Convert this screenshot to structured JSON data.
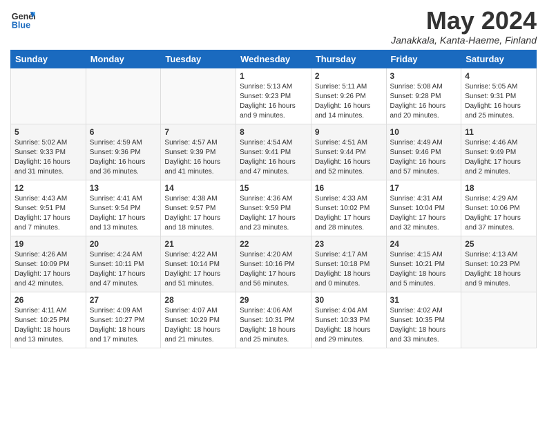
{
  "header": {
    "logo_general": "General",
    "logo_blue": "Blue",
    "month_title": "May 2024",
    "location": "Janakkala, Kanta-Haeme, Finland"
  },
  "days_of_week": [
    "Sunday",
    "Monday",
    "Tuesday",
    "Wednesday",
    "Thursday",
    "Friday",
    "Saturday"
  ],
  "weeks": [
    [
      {
        "day": "",
        "sunrise": "",
        "sunset": "",
        "daylight": ""
      },
      {
        "day": "",
        "sunrise": "",
        "sunset": "",
        "daylight": ""
      },
      {
        "day": "",
        "sunrise": "",
        "sunset": "",
        "daylight": ""
      },
      {
        "day": "1",
        "sunrise": "5:13 AM",
        "sunset": "9:23 PM",
        "daylight": "16 hours and 9 minutes."
      },
      {
        "day": "2",
        "sunrise": "5:11 AM",
        "sunset": "9:26 PM",
        "daylight": "16 hours and 14 minutes."
      },
      {
        "day": "3",
        "sunrise": "5:08 AM",
        "sunset": "9:28 PM",
        "daylight": "16 hours and 20 minutes."
      },
      {
        "day": "4",
        "sunrise": "5:05 AM",
        "sunset": "9:31 PM",
        "daylight": "16 hours and 25 minutes."
      }
    ],
    [
      {
        "day": "5",
        "sunrise": "5:02 AM",
        "sunset": "9:33 PM",
        "daylight": "16 hours and 31 minutes."
      },
      {
        "day": "6",
        "sunrise": "4:59 AM",
        "sunset": "9:36 PM",
        "daylight": "16 hours and 36 minutes."
      },
      {
        "day": "7",
        "sunrise": "4:57 AM",
        "sunset": "9:39 PM",
        "daylight": "16 hours and 41 minutes."
      },
      {
        "day": "8",
        "sunrise": "4:54 AM",
        "sunset": "9:41 PM",
        "daylight": "16 hours and 47 minutes."
      },
      {
        "day": "9",
        "sunrise": "4:51 AM",
        "sunset": "9:44 PM",
        "daylight": "16 hours and 52 minutes."
      },
      {
        "day": "10",
        "sunrise": "4:49 AM",
        "sunset": "9:46 PM",
        "daylight": "16 hours and 57 minutes."
      },
      {
        "day": "11",
        "sunrise": "4:46 AM",
        "sunset": "9:49 PM",
        "daylight": "17 hours and 2 minutes."
      }
    ],
    [
      {
        "day": "12",
        "sunrise": "4:43 AM",
        "sunset": "9:51 PM",
        "daylight": "17 hours and 7 minutes."
      },
      {
        "day": "13",
        "sunrise": "4:41 AM",
        "sunset": "9:54 PM",
        "daylight": "17 hours and 13 minutes."
      },
      {
        "day": "14",
        "sunrise": "4:38 AM",
        "sunset": "9:57 PM",
        "daylight": "17 hours and 18 minutes."
      },
      {
        "day": "15",
        "sunrise": "4:36 AM",
        "sunset": "9:59 PM",
        "daylight": "17 hours and 23 minutes."
      },
      {
        "day": "16",
        "sunrise": "4:33 AM",
        "sunset": "10:02 PM",
        "daylight": "17 hours and 28 minutes."
      },
      {
        "day": "17",
        "sunrise": "4:31 AM",
        "sunset": "10:04 PM",
        "daylight": "17 hours and 32 minutes."
      },
      {
        "day": "18",
        "sunrise": "4:29 AM",
        "sunset": "10:06 PM",
        "daylight": "17 hours and 37 minutes."
      }
    ],
    [
      {
        "day": "19",
        "sunrise": "4:26 AM",
        "sunset": "10:09 PM",
        "daylight": "17 hours and 42 minutes."
      },
      {
        "day": "20",
        "sunrise": "4:24 AM",
        "sunset": "10:11 PM",
        "daylight": "17 hours and 47 minutes."
      },
      {
        "day": "21",
        "sunrise": "4:22 AM",
        "sunset": "10:14 PM",
        "daylight": "17 hours and 51 minutes."
      },
      {
        "day": "22",
        "sunrise": "4:20 AM",
        "sunset": "10:16 PM",
        "daylight": "17 hours and 56 minutes."
      },
      {
        "day": "23",
        "sunrise": "4:17 AM",
        "sunset": "10:18 PM",
        "daylight": "18 hours and 0 minutes."
      },
      {
        "day": "24",
        "sunrise": "4:15 AM",
        "sunset": "10:21 PM",
        "daylight": "18 hours and 5 minutes."
      },
      {
        "day": "25",
        "sunrise": "4:13 AM",
        "sunset": "10:23 PM",
        "daylight": "18 hours and 9 minutes."
      }
    ],
    [
      {
        "day": "26",
        "sunrise": "4:11 AM",
        "sunset": "10:25 PM",
        "daylight": "18 hours and 13 minutes."
      },
      {
        "day": "27",
        "sunrise": "4:09 AM",
        "sunset": "10:27 PM",
        "daylight": "18 hours and 17 minutes."
      },
      {
        "day": "28",
        "sunrise": "4:07 AM",
        "sunset": "10:29 PM",
        "daylight": "18 hours and 21 minutes."
      },
      {
        "day": "29",
        "sunrise": "4:06 AM",
        "sunset": "10:31 PM",
        "daylight": "18 hours and 25 minutes."
      },
      {
        "day": "30",
        "sunrise": "4:04 AM",
        "sunset": "10:33 PM",
        "daylight": "18 hours and 29 minutes."
      },
      {
        "day": "31",
        "sunrise": "4:02 AM",
        "sunset": "10:35 PM",
        "daylight": "18 hours and 33 minutes."
      },
      {
        "day": "",
        "sunrise": "",
        "sunset": "",
        "daylight": ""
      }
    ]
  ]
}
